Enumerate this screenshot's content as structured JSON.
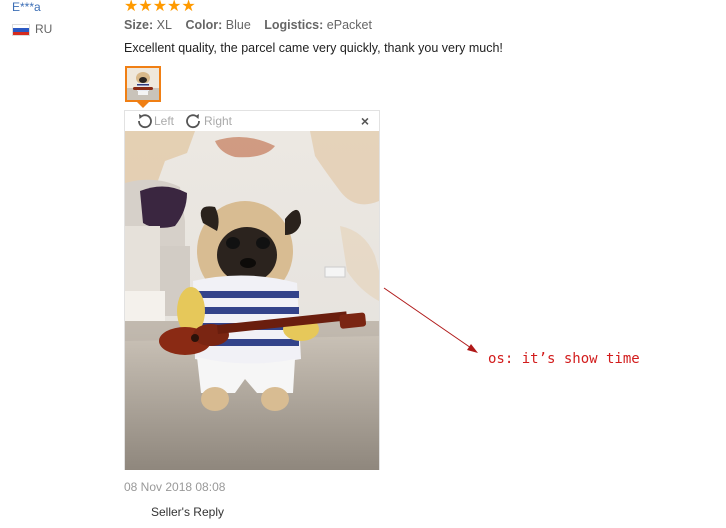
{
  "reviewer": {
    "name": "E***a",
    "country_code": "RU",
    "flag_colors": [
      "#ffffff",
      "#2b59c3",
      "#d52b1e"
    ]
  },
  "review": {
    "rating_stars": 5,
    "stars_glyph": "★★★★★",
    "size_label": "Size:",
    "size_value": "XL",
    "color_label": "Color:",
    "color_value": "Blue",
    "logistics_label": "Logistics:",
    "logistics_value": "ePacket",
    "text": "Excellent quality, the parcel came very quickly, thank you very much!",
    "date": "08 Nov 2018 08:08"
  },
  "viewer": {
    "rotate_left_label": "Left",
    "rotate_right_label": "Right",
    "close_glyph": "×"
  },
  "seller_reply_label": "Seller's Reply",
  "annotation": {
    "text": "os: it’s show time",
    "color": "#d21c1c"
  },
  "colors": {
    "star": "#ff9a00",
    "thumb_border": "#f07f14",
    "user_link": "#3d6fb6"
  }
}
